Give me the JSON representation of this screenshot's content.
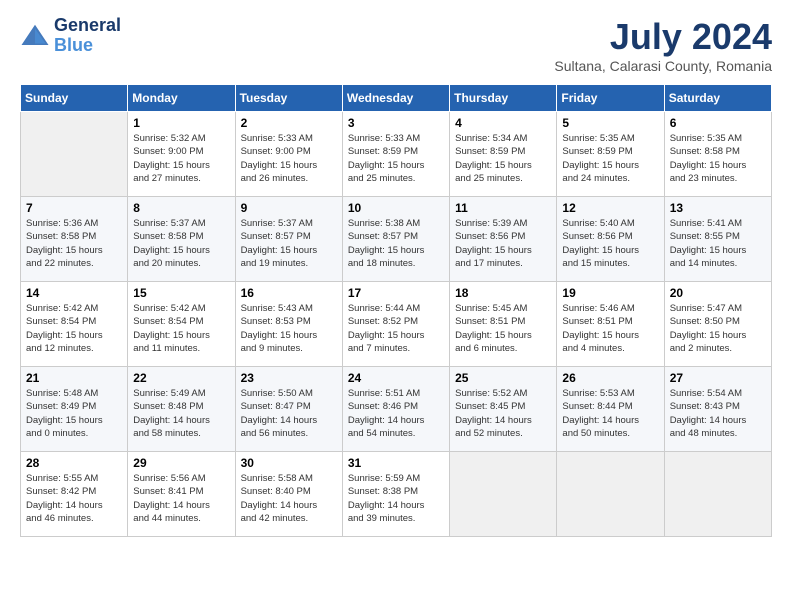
{
  "logo": {
    "line1": "General",
    "line2": "Blue"
  },
  "title": "July 2024",
  "subtitle": "Sultana, Calarasi County, Romania",
  "days_of_week": [
    "Sunday",
    "Monday",
    "Tuesday",
    "Wednesday",
    "Thursday",
    "Friday",
    "Saturday"
  ],
  "weeks": [
    [
      {
        "day": "",
        "info": ""
      },
      {
        "day": "1",
        "info": "Sunrise: 5:32 AM\nSunset: 9:00 PM\nDaylight: 15 hours\nand 27 minutes."
      },
      {
        "day": "2",
        "info": "Sunrise: 5:33 AM\nSunset: 9:00 PM\nDaylight: 15 hours\nand 26 minutes."
      },
      {
        "day": "3",
        "info": "Sunrise: 5:33 AM\nSunset: 8:59 PM\nDaylight: 15 hours\nand 25 minutes."
      },
      {
        "day": "4",
        "info": "Sunrise: 5:34 AM\nSunset: 8:59 PM\nDaylight: 15 hours\nand 25 minutes."
      },
      {
        "day": "5",
        "info": "Sunrise: 5:35 AM\nSunset: 8:59 PM\nDaylight: 15 hours\nand 24 minutes."
      },
      {
        "day": "6",
        "info": "Sunrise: 5:35 AM\nSunset: 8:58 PM\nDaylight: 15 hours\nand 23 minutes."
      }
    ],
    [
      {
        "day": "7",
        "info": "Sunrise: 5:36 AM\nSunset: 8:58 PM\nDaylight: 15 hours\nand 22 minutes."
      },
      {
        "day": "8",
        "info": "Sunrise: 5:37 AM\nSunset: 8:58 PM\nDaylight: 15 hours\nand 20 minutes."
      },
      {
        "day": "9",
        "info": "Sunrise: 5:37 AM\nSunset: 8:57 PM\nDaylight: 15 hours\nand 19 minutes."
      },
      {
        "day": "10",
        "info": "Sunrise: 5:38 AM\nSunset: 8:57 PM\nDaylight: 15 hours\nand 18 minutes."
      },
      {
        "day": "11",
        "info": "Sunrise: 5:39 AM\nSunset: 8:56 PM\nDaylight: 15 hours\nand 17 minutes."
      },
      {
        "day": "12",
        "info": "Sunrise: 5:40 AM\nSunset: 8:56 PM\nDaylight: 15 hours\nand 15 minutes."
      },
      {
        "day": "13",
        "info": "Sunrise: 5:41 AM\nSunset: 8:55 PM\nDaylight: 15 hours\nand 14 minutes."
      }
    ],
    [
      {
        "day": "14",
        "info": "Sunrise: 5:42 AM\nSunset: 8:54 PM\nDaylight: 15 hours\nand 12 minutes."
      },
      {
        "day": "15",
        "info": "Sunrise: 5:42 AM\nSunset: 8:54 PM\nDaylight: 15 hours\nand 11 minutes."
      },
      {
        "day": "16",
        "info": "Sunrise: 5:43 AM\nSunset: 8:53 PM\nDaylight: 15 hours\nand 9 minutes."
      },
      {
        "day": "17",
        "info": "Sunrise: 5:44 AM\nSunset: 8:52 PM\nDaylight: 15 hours\nand 7 minutes."
      },
      {
        "day": "18",
        "info": "Sunrise: 5:45 AM\nSunset: 8:51 PM\nDaylight: 15 hours\nand 6 minutes."
      },
      {
        "day": "19",
        "info": "Sunrise: 5:46 AM\nSunset: 8:51 PM\nDaylight: 15 hours\nand 4 minutes."
      },
      {
        "day": "20",
        "info": "Sunrise: 5:47 AM\nSunset: 8:50 PM\nDaylight: 15 hours\nand 2 minutes."
      }
    ],
    [
      {
        "day": "21",
        "info": "Sunrise: 5:48 AM\nSunset: 8:49 PM\nDaylight: 15 hours\nand 0 minutes."
      },
      {
        "day": "22",
        "info": "Sunrise: 5:49 AM\nSunset: 8:48 PM\nDaylight: 14 hours\nand 58 minutes."
      },
      {
        "day": "23",
        "info": "Sunrise: 5:50 AM\nSunset: 8:47 PM\nDaylight: 14 hours\nand 56 minutes."
      },
      {
        "day": "24",
        "info": "Sunrise: 5:51 AM\nSunset: 8:46 PM\nDaylight: 14 hours\nand 54 minutes."
      },
      {
        "day": "25",
        "info": "Sunrise: 5:52 AM\nSunset: 8:45 PM\nDaylight: 14 hours\nand 52 minutes."
      },
      {
        "day": "26",
        "info": "Sunrise: 5:53 AM\nSunset: 8:44 PM\nDaylight: 14 hours\nand 50 minutes."
      },
      {
        "day": "27",
        "info": "Sunrise: 5:54 AM\nSunset: 8:43 PM\nDaylight: 14 hours\nand 48 minutes."
      }
    ],
    [
      {
        "day": "28",
        "info": "Sunrise: 5:55 AM\nSunset: 8:42 PM\nDaylight: 14 hours\nand 46 minutes."
      },
      {
        "day": "29",
        "info": "Sunrise: 5:56 AM\nSunset: 8:41 PM\nDaylight: 14 hours\nand 44 minutes."
      },
      {
        "day": "30",
        "info": "Sunrise: 5:58 AM\nSunset: 8:40 PM\nDaylight: 14 hours\nand 42 minutes."
      },
      {
        "day": "31",
        "info": "Sunrise: 5:59 AM\nSunset: 8:38 PM\nDaylight: 14 hours\nand 39 minutes."
      },
      {
        "day": "",
        "info": ""
      },
      {
        "day": "",
        "info": ""
      },
      {
        "day": "",
        "info": ""
      }
    ]
  ]
}
